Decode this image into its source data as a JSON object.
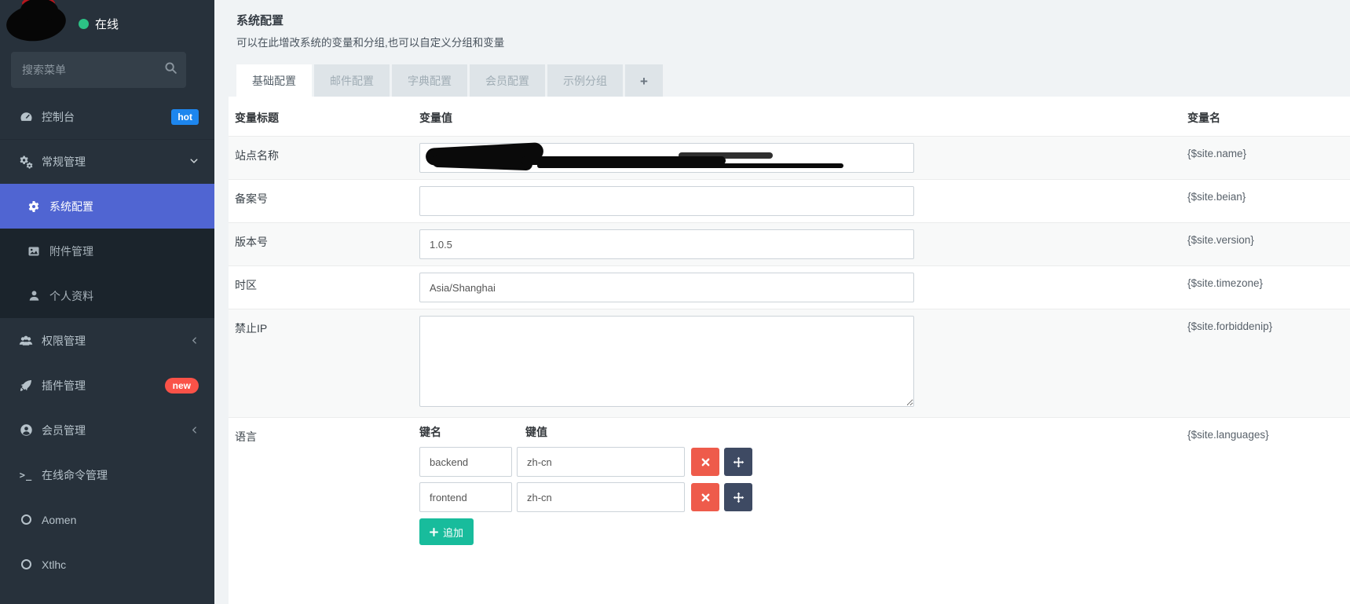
{
  "colors": {
    "sidebar_bg": "#27313b",
    "submenu_bg": "#1b242c",
    "active_item": "#5065d2",
    "hot_badge": "#1d86ee",
    "new_badge": "#fa5248",
    "online_dot": "#2cc185",
    "delete_button": "#ee5b4b",
    "move_button": "#3e4a63",
    "add_button": "#18bc9c"
  },
  "sidebar": {
    "user_status": "在线",
    "search": {
      "placeholder": "搜索菜单"
    },
    "menu": [
      {
        "label": "控制台",
        "icon": "dashboard-icon",
        "badge": "hot"
      },
      {
        "label": "常规管理",
        "icon": "gears-icon",
        "expanded": true,
        "children": [
          {
            "label": "系统配置",
            "icon": "gear-icon",
            "active": true
          },
          {
            "label": "附件管理",
            "icon": "image-icon"
          },
          {
            "label": "个人资料",
            "icon": "user-icon"
          }
        ]
      },
      {
        "label": "权限管理",
        "icon": "users-icon",
        "collapsed": true
      },
      {
        "label": "插件管理",
        "icon": "rocket-icon",
        "badge": "new"
      },
      {
        "label": "会员管理",
        "icon": "user-circle-icon",
        "collapsed": true
      },
      {
        "label": "在线命令管理",
        "icon": "terminal-icon"
      },
      {
        "label": "Aomen",
        "icon": "circle-icon"
      },
      {
        "label": "Xtlhc",
        "icon": "circle-icon"
      }
    ]
  },
  "page": {
    "title": "系统配置",
    "subtitle": "可以在此增改系统的变量和分组,也可以自定义分组和变量"
  },
  "tabs": {
    "items": [
      {
        "label": "基础配置",
        "active": true
      },
      {
        "label": "邮件配置"
      },
      {
        "label": "字典配置"
      },
      {
        "label": "会员配置"
      },
      {
        "label": "示例分组"
      }
    ],
    "add_label": "+"
  },
  "config_table": {
    "headers": {
      "title": "变量标题",
      "value": "变量值",
      "name": "变量名"
    },
    "rows": [
      {
        "title": "站点名称",
        "value": "",
        "redacted": true,
        "varname": "{$site.name}"
      },
      {
        "title": "备案号",
        "value": "",
        "varname": "{$site.beian}"
      },
      {
        "title": "版本号",
        "value": "1.0.5",
        "varname": "{$site.version}"
      },
      {
        "title": "时区",
        "value": "Asia/Shanghai",
        "varname": "{$site.timezone}"
      },
      {
        "title": "禁止IP",
        "value": "",
        "type": "textarea",
        "varname": "{$site.forbiddenip}"
      },
      {
        "title": "语言",
        "type": "key-value",
        "varname": "{$site.languages}"
      }
    ],
    "language_editor": {
      "key_header": "键名",
      "value_header": "键值",
      "rows": [
        {
          "key": "backend",
          "value": "zh-cn"
        },
        {
          "key": "frontend",
          "value": "zh-cn"
        }
      ],
      "add_button": "追加"
    }
  }
}
